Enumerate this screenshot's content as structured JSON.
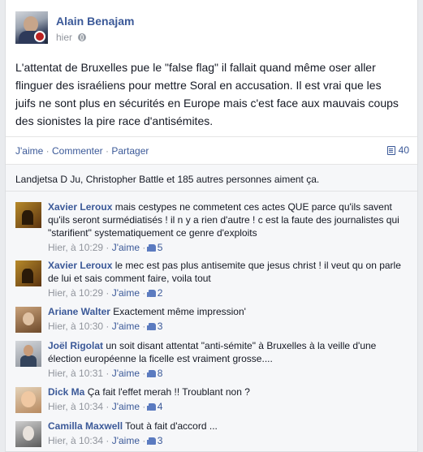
{
  "post": {
    "author": "Alain Benajam",
    "time": "hier",
    "text": "L'attentat de Bruxelles pue le \"false flag\" il fallait quand même oser aller flinguer des israéliens pour mettre Soral en accusation. Il est vrai que les juifs ne sont plus en sécurités en Europe mais c'est face aux mauvais coups des sionistes la pire race d'antisémites.",
    "privacy_icon": "globe-icon"
  },
  "actions": {
    "like": "J'aime",
    "sep": " · ",
    "comment": "Commenter",
    "share": "Partager",
    "comment_count": "40",
    "comment_count_icon": "comment-icon"
  },
  "likes": {
    "names": "Landjetsa D Ju, Christopher Battle",
    "rest": " et 185 autres personnes aiment ça."
  },
  "comments": [
    {
      "author": "Xavier Leroux",
      "text": "mais cestypes ne commetent ces actes QUE parce qu'ils savent qu'ils seront surmédiatisés ! il n y a rien d'autre ! c est la faute des journalistes qui \"starifient\" systematiquement ce genre d'exploits",
      "time": "Hier, à 10:29",
      "like": "J'aime",
      "likes_count": "5"
    },
    {
      "author": "Xavier Leroux",
      "text": "le mec est pas plus antisemite que jesus christ ! il veut qu on parle de lui et sais comment faire, voila tout",
      "time": "Hier, à 10:29",
      "like": "J'aime",
      "likes_count": "2"
    },
    {
      "author": "Ariane Walter",
      "text": "Exactement même impression'",
      "time": "Hier, à 10:30",
      "like": "J'aime",
      "likes_count": "3"
    },
    {
      "author": "Joël Rigolat",
      "text": "un soit disant attentat \"anti-sémite\" à Bruxelles à la veille d'une élection européenne la ficelle est vraiment grosse....",
      "time": "Hier, à 10:31",
      "like": "J'aime",
      "likes_count": "8"
    },
    {
      "author": "Dick Ma",
      "text": "Ça fait l'effet merah !! Troublant non ?",
      "time": "Hier, à 10:34",
      "like": "J'aime",
      "likes_count": "4"
    },
    {
      "author": "Camilla Maxwell",
      "text": "Tout à fait d'accord ...",
      "time": "Hier, à 10:34",
      "like": "J'aime",
      "likes_count": "3"
    }
  ]
}
